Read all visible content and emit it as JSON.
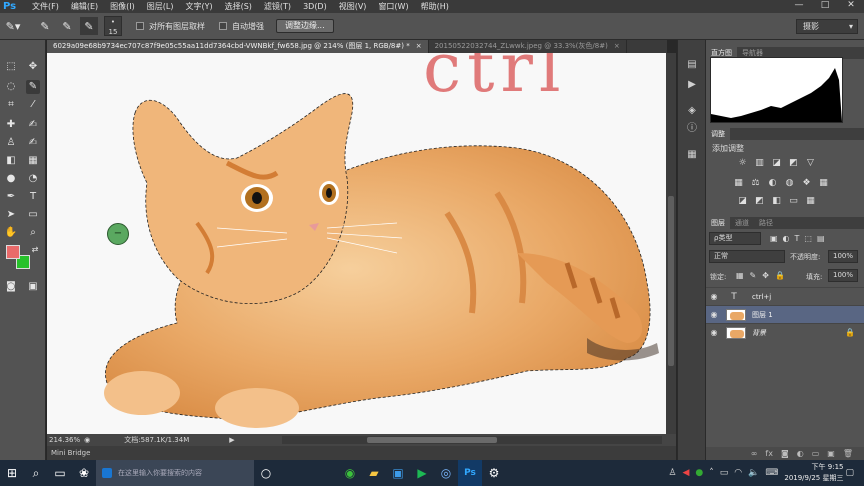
{
  "app": {
    "logo": "Ps"
  },
  "menu": [
    "文件(F)",
    "编辑(E)",
    "图像(I)",
    "图层(L)",
    "文字(Y)",
    "选择(S)",
    "滤镜(T)",
    "3D(D)",
    "视图(V)",
    "窗口(W)",
    "帮助(H)"
  ],
  "window_buttons": [
    "—",
    "□",
    "✕"
  ],
  "options": {
    "brush_size": "15",
    "sample_all_layers": "对所有图层取样",
    "auto_enhance": "自动增强",
    "refine_edge": "调整边缘...",
    "workspace": "摄影"
  },
  "tabs": [
    {
      "label": "6029a09e68b9734ec707c87f9e05c55aa11dd7364cbd-VWNBkf_fw658.jpg @ 214% (图层 1, RGB/8#) *",
      "close": "×"
    },
    {
      "label": "20150522032744_ZLwwk.jpeg @ 33.3%(灰色/8#)",
      "close": "×"
    }
  ],
  "canvas": {
    "text": "ctrl"
  },
  "status": {
    "zoom": "214.36%",
    "doc": "文档:587.1K/1.34M"
  },
  "mini_bridge": "Mini Bridge",
  "panels": {
    "top_tabs": [
      "直方图",
      "导航器"
    ],
    "adjust_tab": "调整",
    "add_adjust": "添加调整",
    "layers_tabs": [
      "图层",
      "通道",
      "路径"
    ],
    "kind": "ρ类型",
    "blend": "正常",
    "opacity_label": "不透明度:",
    "opacity": "100%",
    "lock_label": "锁定:",
    "fill_label": "填充:",
    "fill": "100%"
  },
  "layers": [
    {
      "name": "ctrl+j",
      "type": "text"
    },
    {
      "name": "图层 1",
      "selected": true
    },
    {
      "name": "背景",
      "locked": true
    }
  ],
  "taskbar": {
    "search_placeholder": "在这里输入你要搜索的内容",
    "time": "下午 9:15",
    "date": "2019/9/25 星期三",
    "ps_label": "Ps"
  }
}
